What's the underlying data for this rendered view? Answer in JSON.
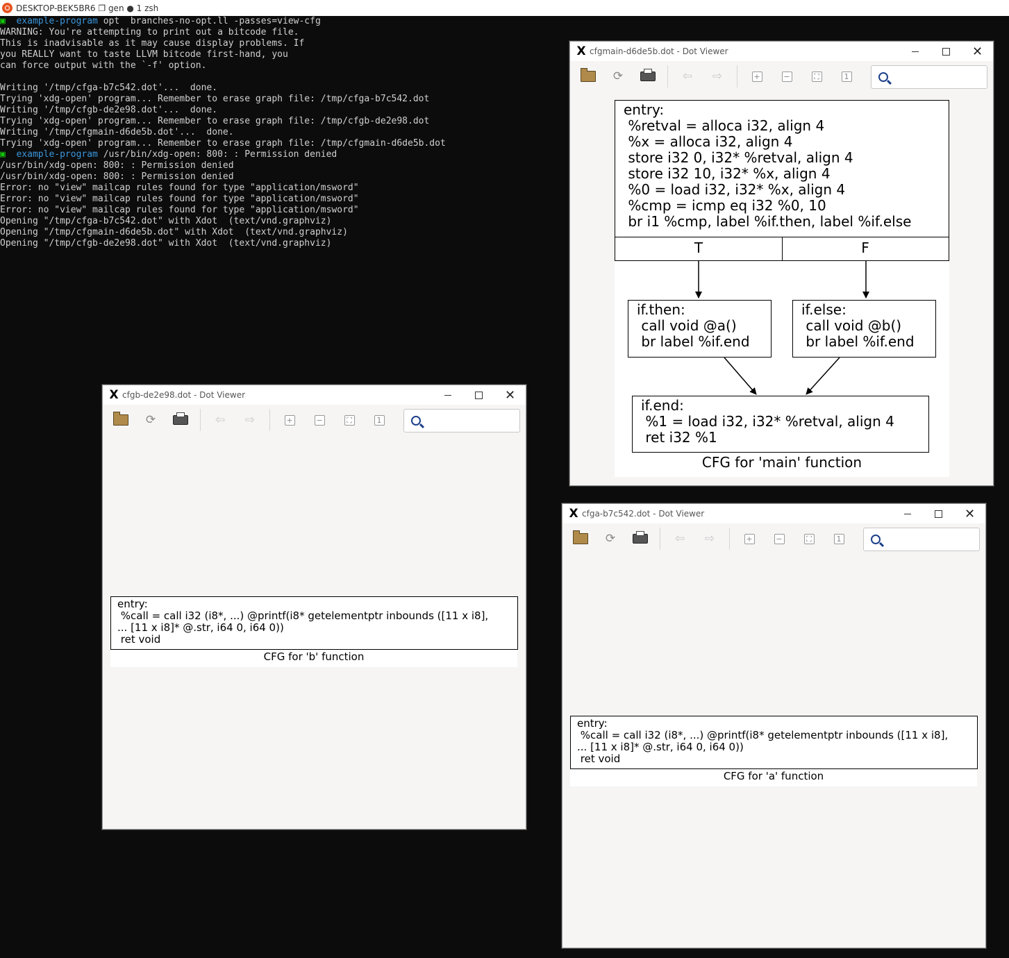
{
  "terminal": {
    "title": "DESKTOP-BEK5BR6 ❐ gen ● 1 zsh",
    "prompt_mark": "▣",
    "prompt_dir": "example-program",
    "lines": [
      {
        "kind": "prompt",
        "text": " opt  branches-no-opt.ll -passes=view-cfg"
      },
      {
        "kind": "out",
        "text": "WARNING: You're attempting to print out a bitcode file."
      },
      {
        "kind": "out",
        "text": "This is inadvisable as it may cause display problems. If"
      },
      {
        "kind": "out",
        "text": "you REALLY want to taste LLVM bitcode first-hand, you"
      },
      {
        "kind": "out",
        "text": "can force output with the `-f' option."
      },
      {
        "kind": "out",
        "text": ""
      },
      {
        "kind": "out",
        "text": "Writing '/tmp/cfga-b7c542.dot'...  done."
      },
      {
        "kind": "out",
        "text": "Trying 'xdg-open' program... Remember to erase graph file: /tmp/cfga-b7c542.dot"
      },
      {
        "kind": "out",
        "text": "Writing '/tmp/cfgb-de2e98.dot'...  done."
      },
      {
        "kind": "out",
        "text": "Trying 'xdg-open' program... Remember to erase graph file: /tmp/cfgb-de2e98.dot"
      },
      {
        "kind": "out",
        "text": "Writing '/tmp/cfgmain-d6de5b.dot'...  done."
      },
      {
        "kind": "out",
        "text": "Trying 'xdg-open' program... Remember to erase graph file: /tmp/cfgmain-d6de5b.dot"
      },
      {
        "kind": "prompt",
        "text": " /usr/bin/xdg-open: 800: : Permission denied"
      },
      {
        "kind": "out",
        "text": "/usr/bin/xdg-open: 800: : Permission denied"
      },
      {
        "kind": "out",
        "text": "/usr/bin/xdg-open: 800: : Permission denied"
      },
      {
        "kind": "out",
        "text": "Error: no \"view\" mailcap rules found for type \"application/msword\""
      },
      {
        "kind": "out",
        "text": "Error: no \"view\" mailcap rules found for type \"application/msword\""
      },
      {
        "kind": "out",
        "text": "Error: no \"view\" mailcap rules found for type \"application/msword\""
      },
      {
        "kind": "out",
        "text": "Opening \"/tmp/cfga-b7c542.dot\" with Xdot  (text/vnd.graphviz)"
      },
      {
        "kind": "out",
        "text": "Opening \"/tmp/cfgmain-d6de5b.dot\" with Xdot  (text/vnd.graphviz)"
      },
      {
        "kind": "out",
        "text": "Opening \"/tmp/cfgb-de2e98.dot\" with Xdot  (text/vnd.graphviz)"
      }
    ]
  },
  "windows": {
    "main": {
      "title": "cfgmain-d6de5b.dot - Dot Viewer",
      "entry_label": "entry:\n %retval = alloca i32, align 4\n %x = alloca i32, align 4\n store i32 0, i32* %retval, align 4\n store i32 10, i32* %x, align 4\n %0 = load i32, i32* %x, align 4\n %cmp = icmp eq i32 %0, 10\n br i1 %cmp, label %if.then, label %if.else",
      "port_true": "T",
      "port_false": "F",
      "then_label": "if.then:\n call void @a()\n br label %if.end",
      "else_label": "if.else:\n call void @b()\n br label %if.end",
      "end_label": "if.end:\n %1 = load i32, i32* %retval, align 4\n ret i32 %1",
      "graph_title": "CFG for 'main' function"
    },
    "b": {
      "title": "cfgb-de2e98.dot - Dot Viewer",
      "entry_label": "entry:\n %call = call i32 (i8*, ...) @printf(i8* getelementptr inbounds ([11 x i8],\n... [11 x i8]* @.str, i64 0, i64 0))\n ret void",
      "graph_title": "CFG for 'b' function"
    },
    "a": {
      "title": "cfga-b7c542.dot - Dot Viewer",
      "entry_label": "entry:\n %call = call i32 (i8*, ...) @printf(i8* getelementptr inbounds ([11 x i8],\n... [11 x i8]* @.str, i64 0, i64 0))\n ret void",
      "graph_title": "CFG for 'a' function"
    }
  },
  "window_controls": {
    "minimize": "—",
    "maximize": "☐",
    "close": "✕"
  },
  "toolbar_icons": [
    "open-icon",
    "reload-icon",
    "print-icon",
    "back-icon",
    "forward-icon",
    "zoom-in-icon",
    "zoom-out-icon",
    "zoom-fit-icon",
    "zoom-100-icon",
    "search-icon"
  ],
  "search": {
    "value": "",
    "placeholder": ""
  }
}
